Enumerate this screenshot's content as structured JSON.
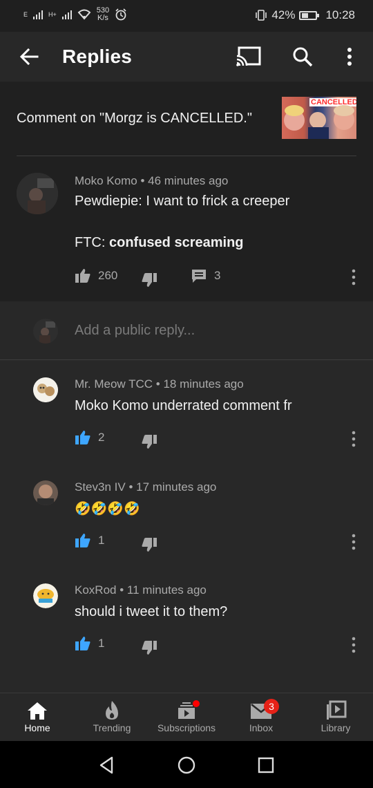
{
  "status_bar": {
    "network_left": "E",
    "network_right": "H+",
    "speed_value": "530",
    "speed_unit": "K/s",
    "battery": "42%",
    "time": "10:28"
  },
  "header": {
    "title": "Replies"
  },
  "context": {
    "text": "Comment on \"Morgz is CANCELLED.\"",
    "thumbnail_label": "CANCELLED"
  },
  "parent_comment": {
    "author": "Moko Komo",
    "time": "46 minutes ago",
    "line1": "Pewdiepie: I want to frick a creeper",
    "line2_prefix": "FTC: ",
    "line2_bold": "confused screaming",
    "likes": "260",
    "replies": "3"
  },
  "reply_input": {
    "placeholder": "Add a public reply..."
  },
  "replies": [
    {
      "author": "Mr. Meow TCC",
      "time": "18 minutes ago",
      "text": "Moko Komo underrated comment fr",
      "likes": "2"
    },
    {
      "author": "Stev3n IV",
      "time": "17 minutes ago",
      "text": "🤣🤣🤣🤣",
      "likes": "1"
    },
    {
      "author": "KoxRod",
      "time": "11 minutes ago",
      "text": "should i tweet it to them?",
      "likes": "1"
    }
  ],
  "separator": "•",
  "bottom_nav": {
    "items": [
      {
        "label": "Home"
      },
      {
        "label": "Trending"
      },
      {
        "label": "Subscriptions"
      },
      {
        "label": "Inbox",
        "badge": "3"
      },
      {
        "label": "Library"
      }
    ]
  },
  "colors": {
    "background": "#282828",
    "parent_background": "#202020",
    "like_active": "#3ea6ff",
    "badge": "#e62117"
  }
}
